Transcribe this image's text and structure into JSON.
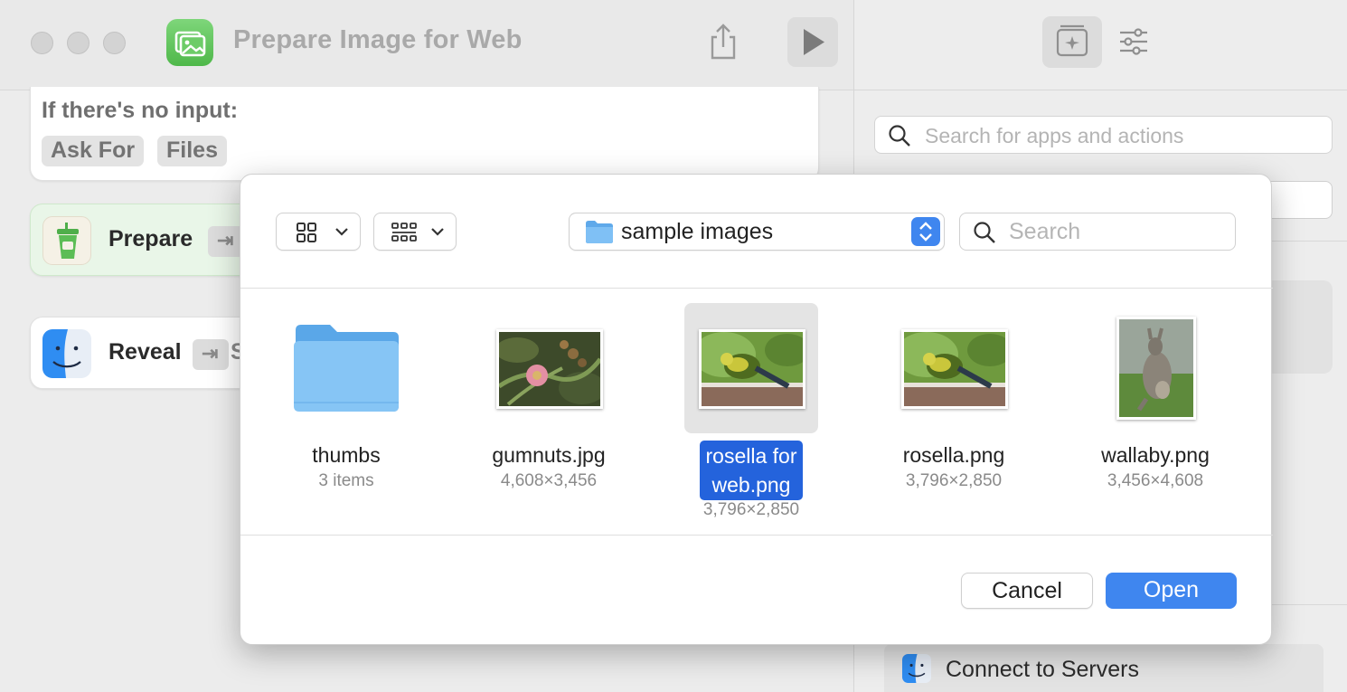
{
  "window": {
    "title": "Prepare Image for Web"
  },
  "workflow": {
    "no_input_label": "If there's no input:",
    "chips": [
      "Ask For",
      "Files"
    ],
    "actions": [
      {
        "label": "Prepare",
        "chip": "⇥"
      },
      {
        "label": "Reveal",
        "chip": "⇥",
        "chip_trailing": "S"
      }
    ]
  },
  "sidebar": {
    "search_placeholder": "Search for apps and actions",
    "bottom_item": "Connect to Servers"
  },
  "dialog": {
    "location": "sample images",
    "search_placeholder": "Search",
    "files": [
      {
        "name": "thumbs",
        "meta": "3 items",
        "kind": "folder"
      },
      {
        "name": "gumnuts.jpg",
        "meta": "4,608×3,456",
        "kind": "image"
      },
      {
        "name": "rosella for web.png",
        "name_line1": "rosella for",
        "name_line2": "web.png",
        "meta": "3,796×2,850",
        "kind": "image",
        "selected": true
      },
      {
        "name": "rosella.png",
        "meta": "3,796×2,850",
        "kind": "image"
      },
      {
        "name": "wallaby.png",
        "meta": "3,456×4,608",
        "kind": "image"
      }
    ],
    "cancel_label": "Cancel",
    "open_label": "Open"
  },
  "colors": {
    "accent": "#3f86ef",
    "selection": "#2463dc",
    "app_icon": "#5cc157"
  },
  "icons": [
    "share-icon",
    "play-icon",
    "library-icon",
    "settings-sliders-icon",
    "search-icon",
    "grid-view-icon",
    "gallery-view-icon",
    "folder-icon",
    "stepper-icon",
    "finder-icon"
  ]
}
